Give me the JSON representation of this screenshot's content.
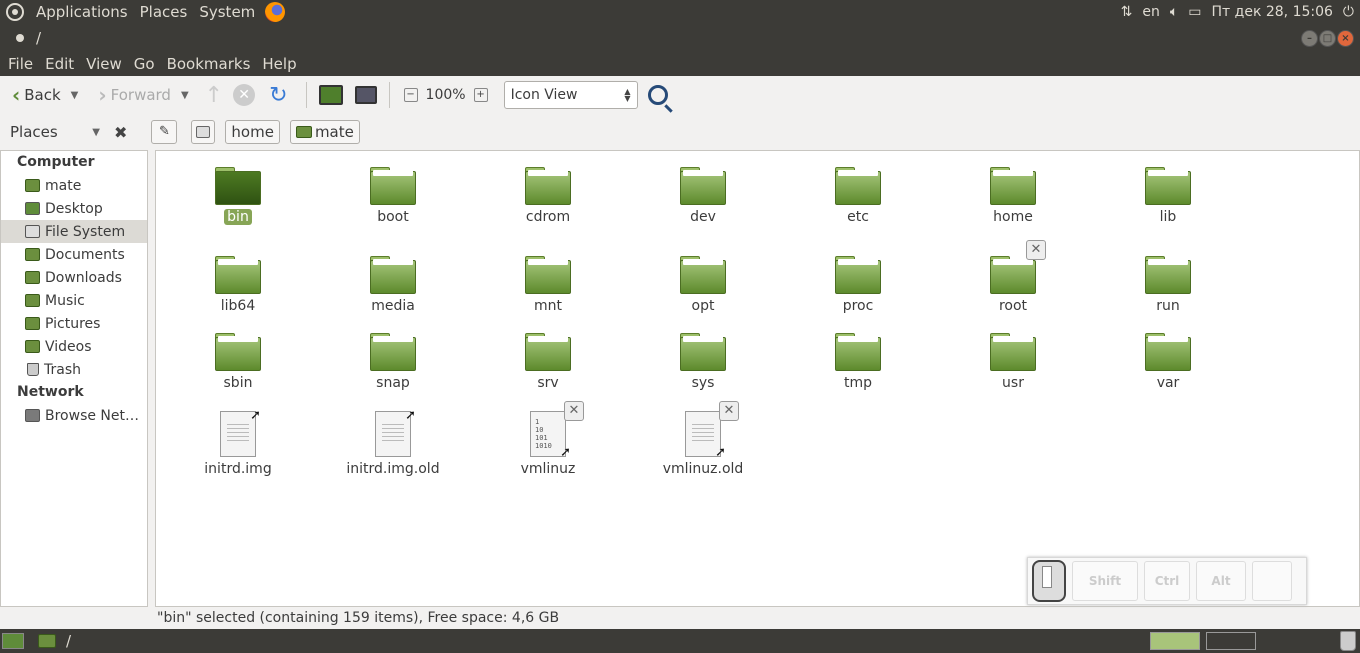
{
  "top_panel": {
    "menus": [
      "Applications",
      "Places",
      "System"
    ],
    "keyboard_layout": "en",
    "clock": "Пт дек 28, 15:06"
  },
  "window": {
    "title": "/"
  },
  "menubar": [
    "File",
    "Edit",
    "View",
    "Go",
    "Bookmarks",
    "Help"
  ],
  "toolbar": {
    "back_label": "Back",
    "forward_label": "Forward",
    "zoom_level": "100%",
    "view_mode": "Icon View"
  },
  "location": {
    "pane_label": "Places",
    "crumbs": [
      "home",
      "mate"
    ]
  },
  "sidebar": {
    "sections": [
      {
        "heading": "Computer",
        "items": [
          {
            "label": "mate",
            "icon": "home-folder-icon"
          },
          {
            "label": "Desktop",
            "icon": "desktop-icon"
          },
          {
            "label": "File System",
            "icon": "drive-icon",
            "active": true
          },
          {
            "label": "Documents",
            "icon": "folder-icon"
          },
          {
            "label": "Downloads",
            "icon": "folder-icon"
          },
          {
            "label": "Music",
            "icon": "folder-icon"
          },
          {
            "label": "Pictures",
            "icon": "folder-icon"
          },
          {
            "label": "Videos",
            "icon": "folder-icon"
          },
          {
            "label": "Trash",
            "icon": "trash-icon"
          }
        ]
      },
      {
        "heading": "Network",
        "items": [
          {
            "label": "Browse Net…",
            "icon": "network-icon"
          }
        ]
      }
    ]
  },
  "files": [
    {
      "name": "bin",
      "type": "folder",
      "selected": true
    },
    {
      "name": "boot",
      "type": "folder"
    },
    {
      "name": "cdrom",
      "type": "folder"
    },
    {
      "name": "dev",
      "type": "folder"
    },
    {
      "name": "etc",
      "type": "folder"
    },
    {
      "name": "home",
      "type": "folder"
    },
    {
      "name": "lib",
      "type": "folder"
    },
    {
      "name": "lib64",
      "type": "folder"
    },
    {
      "name": "media",
      "type": "folder"
    },
    {
      "name": "mnt",
      "type": "folder"
    },
    {
      "name": "opt",
      "type": "folder"
    },
    {
      "name": "proc",
      "type": "folder"
    },
    {
      "name": "root",
      "type": "folder",
      "locked": true
    },
    {
      "name": "run",
      "type": "folder"
    },
    {
      "name": "sbin",
      "type": "folder"
    },
    {
      "name": "snap",
      "type": "folder"
    },
    {
      "name": "srv",
      "type": "folder"
    },
    {
      "name": "sys",
      "type": "folder"
    },
    {
      "name": "tmp",
      "type": "folder"
    },
    {
      "name": "usr",
      "type": "folder"
    },
    {
      "name": "var",
      "type": "folder"
    },
    {
      "name": "initrd.img",
      "type": "text-link"
    },
    {
      "name": "initrd.img.old",
      "type": "text-link"
    },
    {
      "name": "vmlinuz",
      "type": "binary-link",
      "locked": true,
      "binary_text": "1\n10\n101\n1010"
    },
    {
      "name": "vmlinuz.old",
      "type": "text-link",
      "locked": true
    }
  ],
  "status": "\"bin\" selected (containing 159 items), Free space: 4,6 GB",
  "osk": {
    "keys": [
      "Shift",
      "Ctrl",
      "Alt",
      ""
    ]
  },
  "bottom_panel": {
    "task_title": "/"
  },
  "colors": {
    "panel": "#3c3b37",
    "accent_green": "#87a556",
    "folder_green": "#6b8f3e"
  }
}
